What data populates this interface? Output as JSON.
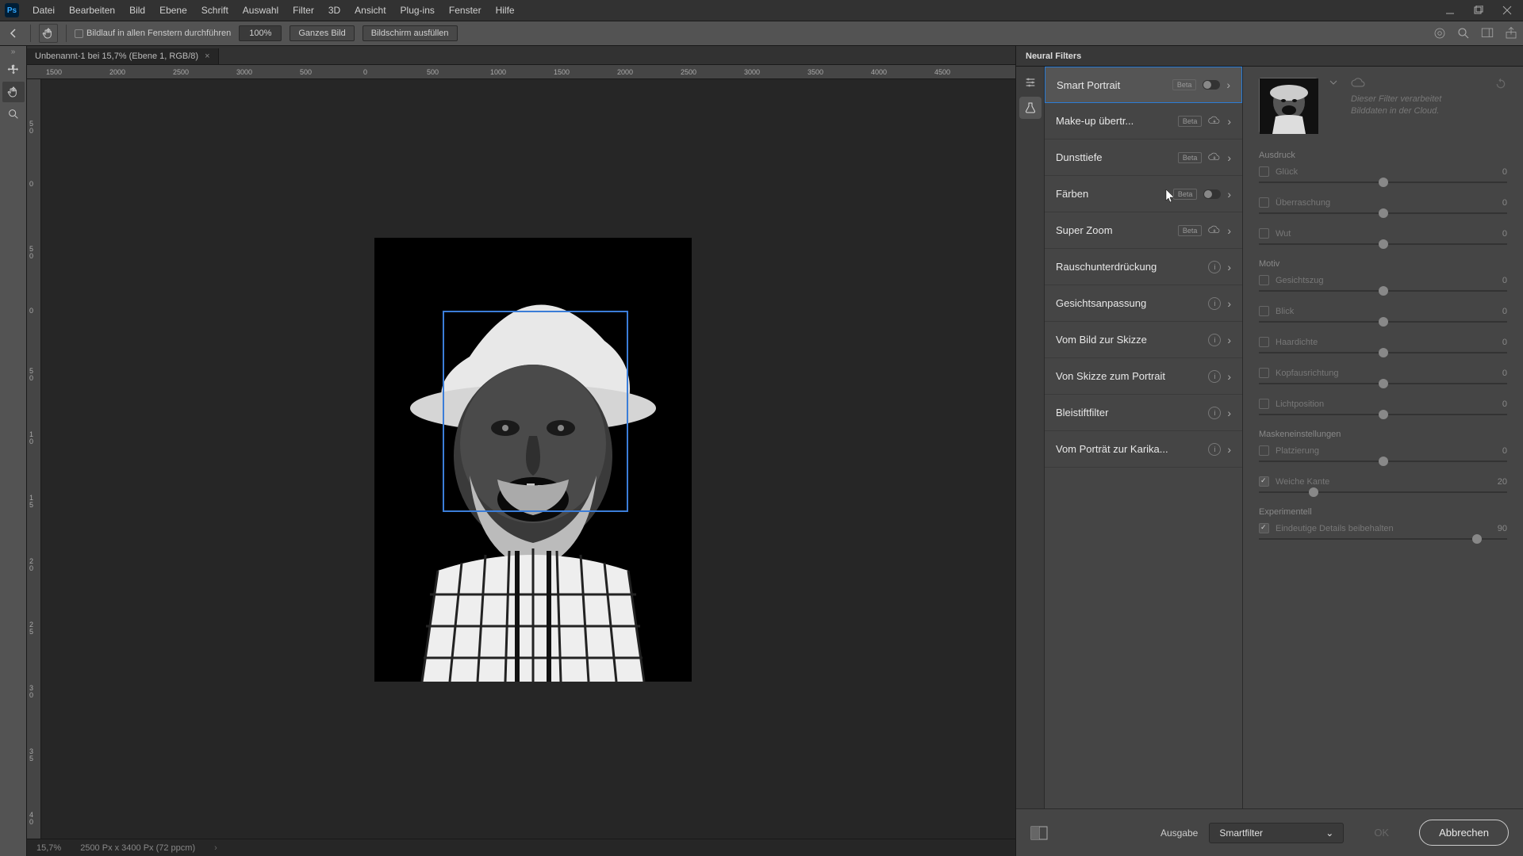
{
  "menu": {
    "items": [
      "Datei",
      "Bearbeiten",
      "Bild",
      "Ebene",
      "Schrift",
      "Auswahl",
      "Filter",
      "3D",
      "Ansicht",
      "Plug-ins",
      "Fenster",
      "Hilfe"
    ]
  },
  "options": {
    "scroll_all": "Bildlauf in allen Fenstern durchführen",
    "zoom": "100%",
    "whole": "Ganzes Bild",
    "fill": "Bildschirm ausfüllen"
  },
  "doc": {
    "tab": "Unbenannt-1 bei 15,7% (Ebene 1, RGB/8)",
    "zoom": "15,7%",
    "dims": "2500 Px x 3400 Px (72 ppcm)"
  },
  "ruler_h": [
    "1500",
    "2000",
    "2500",
    "3000",
    "500",
    "0",
    "500",
    "1000",
    "1500",
    "2000",
    "2500",
    "3000",
    "3500",
    "4000",
    "4500"
  ],
  "ruler_v": [
    {
      "n": "5",
      "s": "0",
      "t": 52
    },
    {
      "n": "0",
      "s": "",
      "t": 128
    },
    {
      "n": "5",
      "s": "0",
      "t": 210
    },
    {
      "n": "0",
      "s": "",
      "t": 288
    },
    {
      "n": "5",
      "s": "0",
      "t": 364
    },
    {
      "n": "1",
      "s": "0",
      "t": 444
    },
    {
      "n": "1",
      "s": "5",
      "t": 524
    },
    {
      "n": "2",
      "s": "0",
      "t": 604
    },
    {
      "n": "2",
      "s": "5",
      "t": 684
    },
    {
      "n": "3",
      "s": "0",
      "t": 764
    },
    {
      "n": "3",
      "s": "5",
      "t": 844
    },
    {
      "n": "4",
      "s": "0",
      "t": 924
    }
  ],
  "nf": {
    "title": "Neural Filters",
    "filters": [
      {
        "name": "Smart Portrait",
        "beta": true,
        "kind": "toggle",
        "selected": true
      },
      {
        "name": "Make-up übertr...",
        "beta": true,
        "kind": "download"
      },
      {
        "name": "Dunsttiefe",
        "beta": true,
        "kind": "download"
      },
      {
        "name": "Färben",
        "beta": true,
        "kind": "toggle"
      },
      {
        "name": "Super Zoom",
        "beta": true,
        "kind": "download"
      },
      {
        "name": "Rauschunterdrückung",
        "beta": false,
        "kind": "info"
      },
      {
        "name": "Gesichtsanpassung",
        "beta": false,
        "kind": "info"
      },
      {
        "name": "Vom Bild zur Skizze",
        "beta": false,
        "kind": "info"
      },
      {
        "name": "Von Skizze zum Portrait",
        "beta": false,
        "kind": "info"
      },
      {
        "name": "Bleistiftfilter",
        "beta": false,
        "kind": "info"
      },
      {
        "name": "Vom Porträt zur Karika...",
        "beta": false,
        "kind": "info"
      }
    ],
    "cloud_note_1": "Dieser Filter verarbeitet",
    "cloud_note_2": "Bilddaten in der Cloud.",
    "sections": {
      "ausdruck": "Ausdruck",
      "motiv": "Motiv",
      "mask": "Maskeneinstellungen",
      "exp": "Experimentell"
    },
    "sliders": [
      {
        "section": "ausdruck",
        "label": "Glück",
        "val": "0",
        "pos": 50,
        "on": false
      },
      {
        "section": "ausdruck",
        "label": "Überraschung",
        "val": "0",
        "pos": 50,
        "on": false
      },
      {
        "section": "ausdruck",
        "label": "Wut",
        "val": "0",
        "pos": 50,
        "on": false
      },
      {
        "section": "motiv",
        "label": "Gesichtszug",
        "val": "0",
        "pos": 50,
        "on": false
      },
      {
        "section": "motiv",
        "label": "Blick",
        "val": "0",
        "pos": 50,
        "on": false
      },
      {
        "section": "motiv",
        "label": "Haardichte",
        "val": "0",
        "pos": 50,
        "on": false
      },
      {
        "section": "motiv",
        "label": "Kopfausrichtung",
        "val": "0",
        "pos": 50,
        "on": false
      },
      {
        "section": "motiv",
        "label": "Lichtposition",
        "val": "0",
        "pos": 50,
        "on": false
      },
      {
        "section": "mask",
        "label": "Platzierung",
        "val": "0",
        "pos": 50,
        "on": false
      },
      {
        "section": "mask",
        "label": "Weiche Kante",
        "val": "20",
        "pos": 22,
        "on": true
      },
      {
        "section": "exp",
        "label": "Eindeutige Details beibehalten",
        "val": "90",
        "pos": 88,
        "on": true
      }
    ],
    "output_label": "Ausgabe",
    "output_value": "Smartfilter",
    "ok": "OK",
    "cancel": "Abbrechen"
  }
}
